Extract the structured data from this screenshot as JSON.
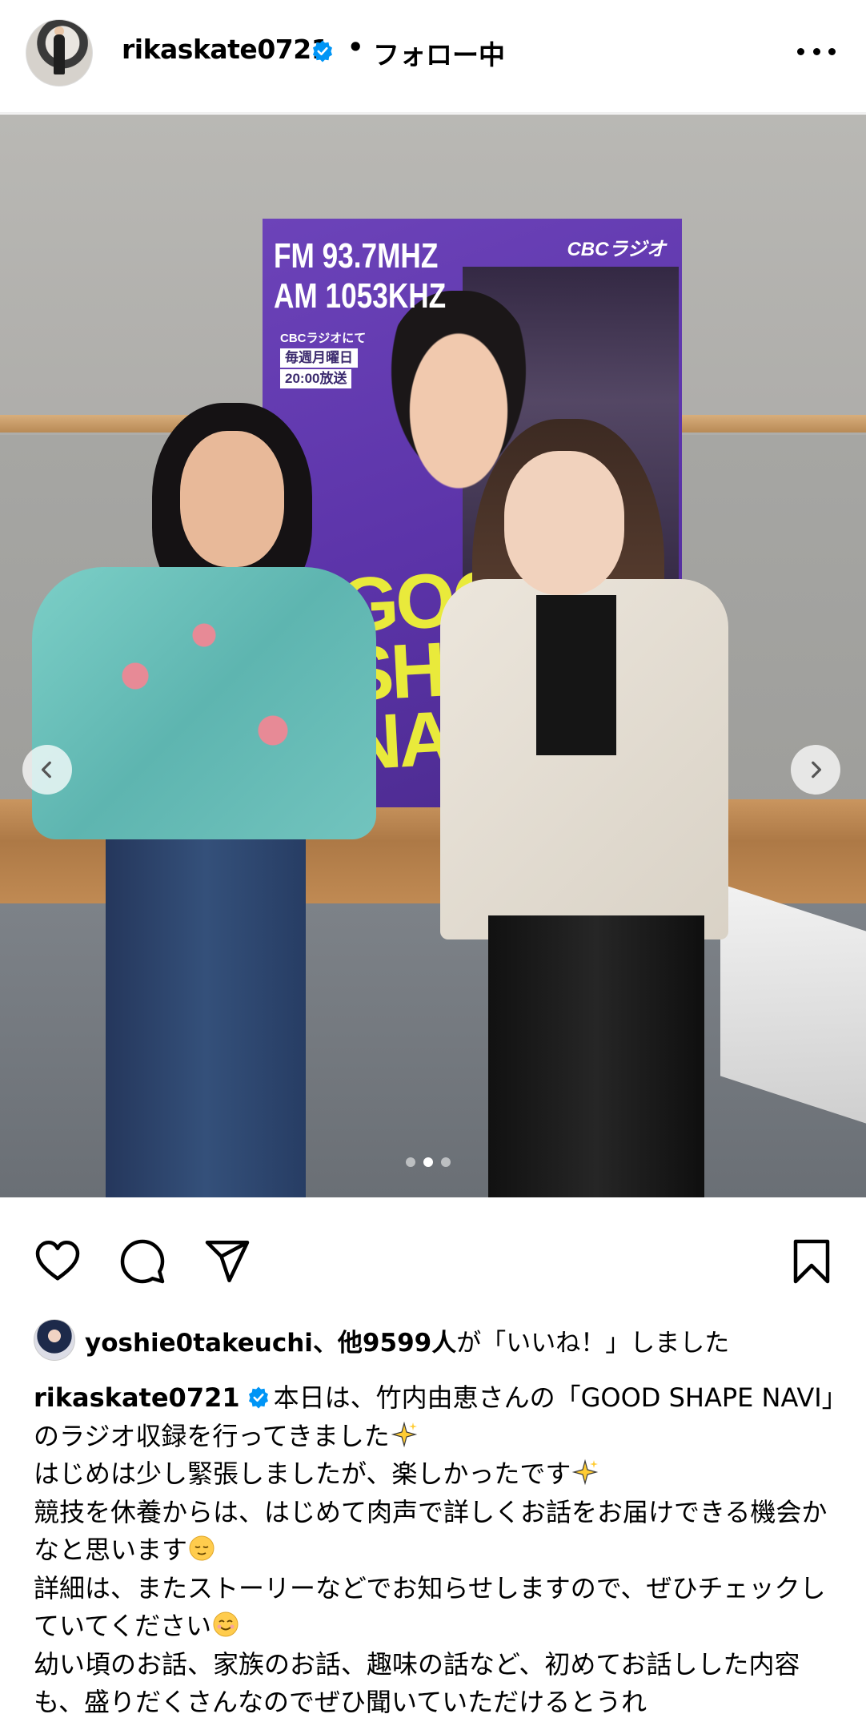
{
  "header": {
    "username": "rikaskate0721",
    "separator": "•",
    "follow_label": "フォロー中"
  },
  "post": {
    "carousel": {
      "count": 3,
      "active_index": 1
    },
    "poster_text": {
      "fm": "FM 93.7MHZ",
      "am": "AM 1053KHZ",
      "brand": "CBCラジオ",
      "schedule_line1": "CBCラジオにて",
      "schedule_line2": "毎週月曜日",
      "schedule_line3": "20:00放送",
      "title": "GOOD SHAPE NAVI"
    }
  },
  "likes": {
    "liker": "yoshie0takeuchi",
    "others": "、他9599人",
    "suffix": "が「いいね！」しました"
  },
  "caption": {
    "username": "rikaskate0721",
    "line1": "本日は、竹内由恵さんの「GOOD SHAPE NAVI」　のラジオ収録を行ってきました",
    "line2": "はじめは少し緊張しましたが、楽しかったです",
    "line3": "競技を休養からは、はじめて肉声で詳しくお話をお届けできる機会かなと思います",
    "line4": "詳細は、またストーリーなどでお知らせしますので、ぜひチェックしていてください",
    "line5": "幼い頃のお話、家族のお話、趣味の話など、初めてお話しした内容も、盛りだくさんなのでぜひ聞いていただけるとうれ"
  },
  "colors": {
    "verified_blue": "#0095f6",
    "poster_purple": "#5b33a8",
    "poster_yellow": "#e9ea3b"
  },
  "icons": [
    "verified-icon",
    "more-icon",
    "chevron-left-icon",
    "chevron-right-icon",
    "heart-icon",
    "comment-icon",
    "share-icon",
    "bookmark-icon",
    "sparkles-emoji",
    "relieved-emoji",
    "smiling-emoji"
  ]
}
